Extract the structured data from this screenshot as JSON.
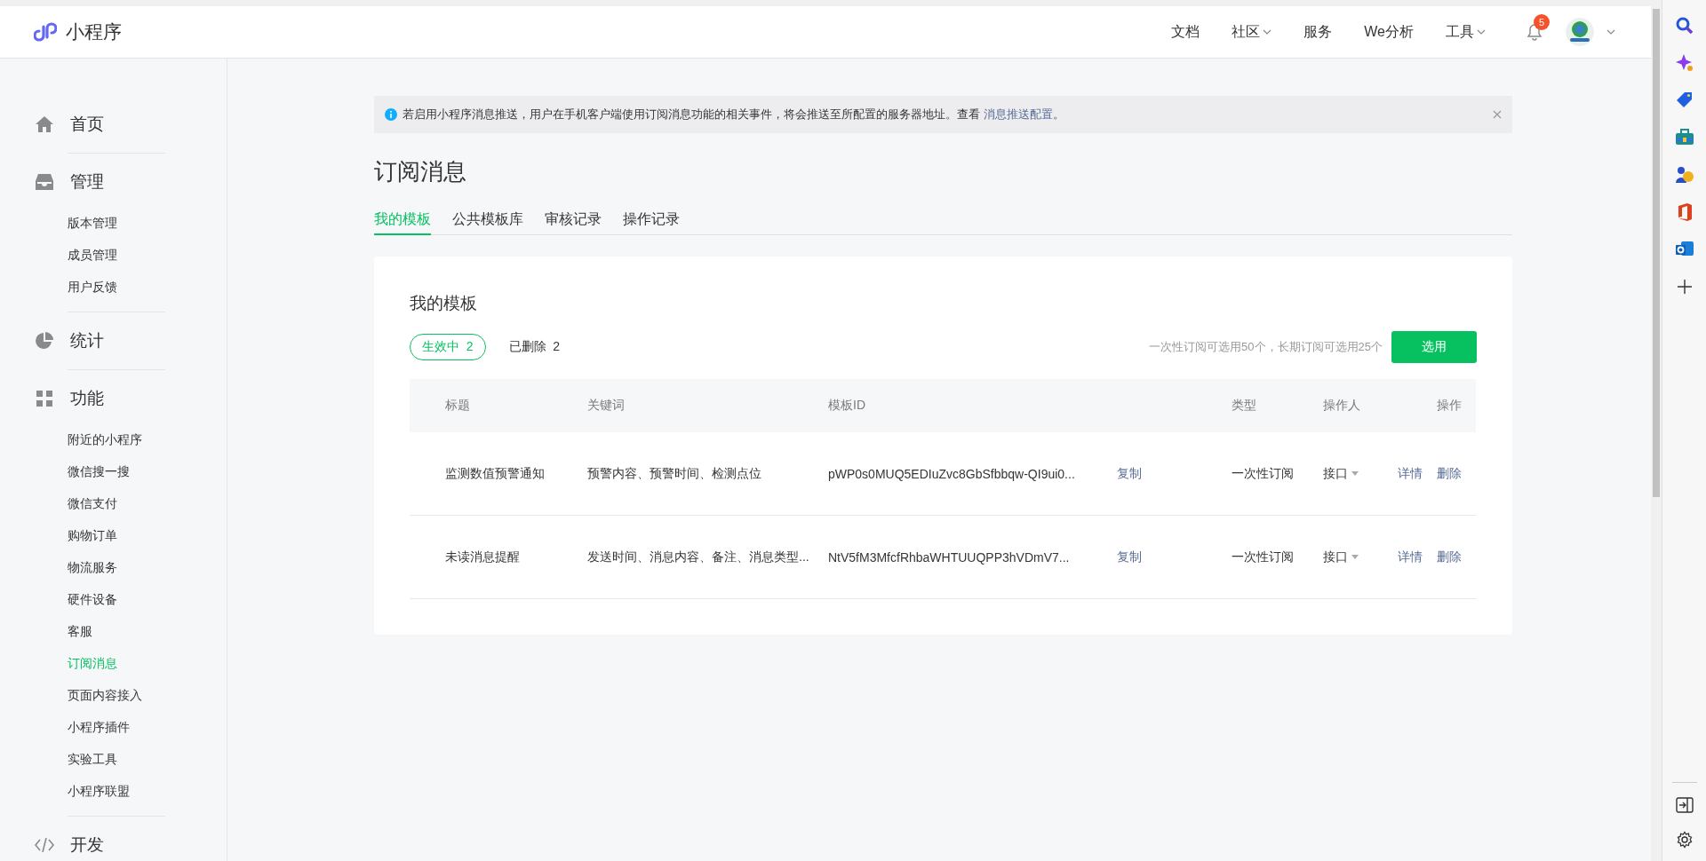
{
  "header": {
    "logo": "小程序",
    "nav": [
      {
        "label": "文档",
        "dropdown": false
      },
      {
        "label": "社区",
        "dropdown": true
      },
      {
        "label": "服务",
        "dropdown": false
      },
      {
        "label": "We分析",
        "dropdown": false
      },
      {
        "label": "工具",
        "dropdown": true
      }
    ],
    "notifications": "5"
  },
  "sidebar": [
    {
      "label": "首页",
      "selected": false
    },
    {
      "label": "管理",
      "selected": false,
      "children": [
        {
          "label": "版本管理",
          "selected": false
        },
        {
          "label": "成员管理",
          "selected": false
        },
        {
          "label": "用户反馈",
          "selected": false
        }
      ]
    },
    {
      "label": "统计",
      "selected": false
    },
    {
      "label": "功能",
      "selected": false,
      "children": [
        {
          "label": "附近的小程序",
          "selected": false
        },
        {
          "label": "微信搜一搜",
          "selected": false
        },
        {
          "label": "微信支付",
          "selected": false
        },
        {
          "label": "购物订单",
          "selected": false
        },
        {
          "label": "物流服务",
          "selected": false
        },
        {
          "label": "硬件设备",
          "selected": false
        },
        {
          "label": "客服",
          "selected": false
        },
        {
          "label": "订阅消息",
          "selected": true
        },
        {
          "label": "页面内容接入",
          "selected": false
        },
        {
          "label": "小程序插件",
          "selected": false
        },
        {
          "label": "实验工具",
          "selected": false
        },
        {
          "label": "小程序联盟",
          "selected": false
        }
      ]
    },
    {
      "label": "开发",
      "selected": false
    }
  ],
  "notice": {
    "text": "若启用小程序消息推送，用户在手机客户端使用订阅消息功能的相关事件，将会推送至所配置的服务器地址。查看",
    "link": "消息推送配置",
    "after": "。"
  },
  "title": "订阅消息",
  "tabs": [
    {
      "label": "我的模板",
      "selected": true
    },
    {
      "label": "公共模板库",
      "selected": false
    },
    {
      "label": "审核记录",
      "selected": false
    },
    {
      "label": "操作记录",
      "selected": false
    }
  ],
  "card": {
    "title": "我的模板",
    "filters": [
      {
        "label": "生效中",
        "count": "2",
        "selected": true
      },
      {
        "label": "已删除",
        "count": "2",
        "selected": false
      }
    ],
    "quota": "一次性订阅可选用50个，长期订阅可选用25个",
    "button": "选用",
    "columns": [
      "标题",
      "关键词",
      "模板ID",
      "类型",
      "操作人",
      "操作"
    ],
    "rows": [
      {
        "title": "监测数值预警通知",
        "keywords": "预警内容、预警时间、检测点位",
        "id": "pWP0s0MUQ5EDIuZvc8GbSfbbqw-QI9ui0...",
        "copy": "复制",
        "type": "一次性订阅",
        "operator": "接口",
        "actions": [
          "详情",
          "删除"
        ]
      },
      {
        "title": "未读消息提醒",
        "keywords": "发送时间、消息内容、备注、消息类型...",
        "id": "NtV5fM3MfcfRhbaWHTUUQPP3hVDmV7...",
        "copy": "复制",
        "type": "一次性订阅",
        "operator": "接口",
        "actions": [
          "详情",
          "删除"
        ]
      }
    ]
  }
}
